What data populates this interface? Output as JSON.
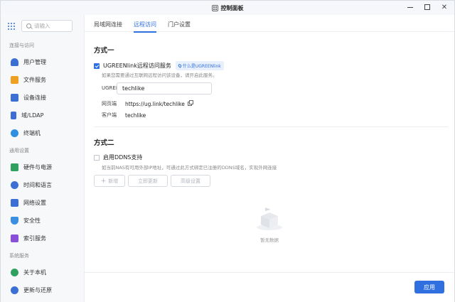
{
  "window": {
    "title": "控制面板"
  },
  "sidebar": {
    "search_placeholder": "请输入",
    "groups": [
      {
        "label": "连接与访问",
        "items": [
          {
            "label": "用户管理",
            "icon": "user-icon",
            "color": "#3b6fd4"
          },
          {
            "label": "文件服务",
            "icon": "folder-icon",
            "color": "#f0a020"
          },
          {
            "label": "设备连接",
            "icon": "device-icon",
            "color": "#3b6fd4"
          },
          {
            "label": "域/LDAP",
            "icon": "domain-icon",
            "color": "#3b6fd4"
          },
          {
            "label": "终端机",
            "icon": "terminal-icon",
            "color": "#2f8fe0"
          }
        ]
      },
      {
        "label": "通用设置",
        "items": [
          {
            "label": "硬件与电源",
            "icon": "power-icon",
            "color": "#2fa060"
          },
          {
            "label": "时间和语言",
            "icon": "clock-icon",
            "color": "#3b6fd4"
          },
          {
            "label": "网络设置",
            "icon": "network-icon",
            "color": "#3b6fd4"
          },
          {
            "label": "安全性",
            "icon": "shield-icon",
            "color": "#3b8fe0"
          },
          {
            "label": "索引服务",
            "icon": "index-icon",
            "color": "#8a4fd8"
          }
        ]
      },
      {
        "label": "系统服务",
        "items": [
          {
            "label": "关于本机",
            "icon": "info-icon",
            "color": "#2fa060"
          },
          {
            "label": "更新与还原",
            "icon": "refresh-icon",
            "color": "#3b6fd4"
          }
        ]
      }
    ]
  },
  "tabs": [
    {
      "label": "局域网连接",
      "active": false
    },
    {
      "label": "远程访问",
      "active": true
    },
    {
      "label": "门户设置",
      "active": false
    }
  ],
  "method1": {
    "title": "方式一",
    "checkbox_label": "UGREENlink远程访问服务",
    "checked": true,
    "badge": "什么是UGREENlink",
    "hint": "如果您需要通过互联网远程访问该设备，请开启此服务。",
    "id_label": "UGREENlink ID",
    "id_value": "techlike",
    "web_label": "网页端",
    "web_value": "https://ug.link/techlike",
    "client_label": "客户端",
    "client_value": "techlike"
  },
  "method2": {
    "title": "方式二",
    "checkbox_label": "启用DDNS支持",
    "checked": false,
    "hint": "如当前NAS有可用外部IP地址，可通过此方式绑定已注册的DDNS域名，实现外网连接",
    "add_label": "新增",
    "update_label": "立即更新",
    "settings_label": "高级设置",
    "empty_text": "暂无数据"
  },
  "footer": {
    "apply_label": "应用"
  },
  "colors": {
    "accent": "#2f6fe0"
  }
}
